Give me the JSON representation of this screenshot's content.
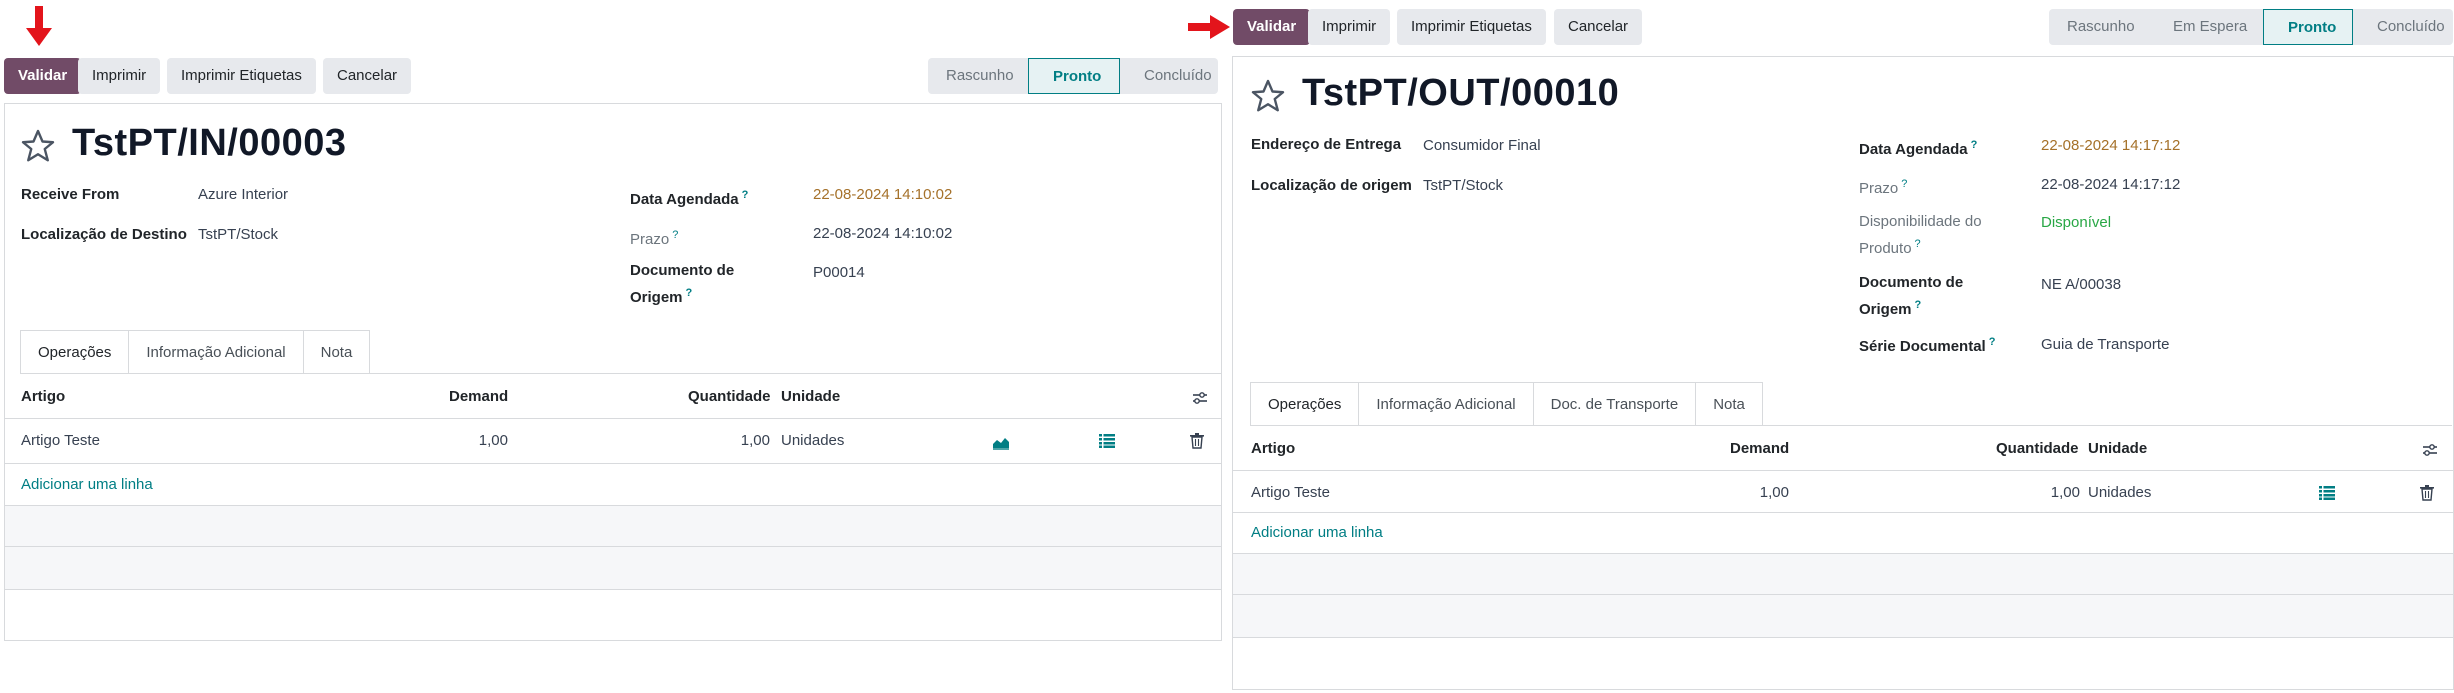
{
  "left": {
    "buttons": {
      "validate": "Validar",
      "print": "Imprimir",
      "print_labels": "Imprimir Etiquetas",
      "cancel": "Cancelar"
    },
    "status": [
      "Rascunho",
      "Pronto",
      "Concluído"
    ],
    "status_active": "Pronto",
    "title": "TstPT/IN/00003",
    "fields": {
      "receive_from_label": "Receive From",
      "receive_from_value": "Azure Interior",
      "dest_location_label": "Localização de Destino",
      "dest_location_value": "TstPT/Stock",
      "scheduled_label": "Data Agendada",
      "scheduled_value": "22-08-2024 14:10:02",
      "deadline_label": "Prazo",
      "deadline_value": "22-08-2024 14:10:02",
      "origin_label_1": "Documento de",
      "origin_label_2": "Origem",
      "origin_value": "P00014"
    },
    "tabs": [
      "Operações",
      "Informação Adicional",
      "Nota"
    ],
    "table": {
      "headers": [
        "Artigo",
        "Demand",
        "Quantidade",
        "Unidade"
      ],
      "row": {
        "product": "Artigo Teste",
        "demand": "1,00",
        "quantity": "1,00",
        "unit": "Unidades"
      },
      "add_line": "Adicionar uma linha"
    }
  },
  "right": {
    "buttons": {
      "validate": "Validar",
      "print": "Imprimir",
      "print_labels": "Imprimir Etiquetas",
      "cancel": "Cancelar"
    },
    "status": [
      "Rascunho",
      "Em Espera",
      "Pronto",
      "Concluído"
    ],
    "status_active": "Pronto",
    "title": "TstPT/OUT/00010",
    "fields": {
      "delivery_address_label": "Endereço de Entrega",
      "delivery_address_value": "Consumidor Final",
      "source_location_label": "Localização de origem",
      "source_location_value": "TstPT/Stock",
      "scheduled_label": "Data Agendada",
      "scheduled_value": "22-08-2024 14:17:12",
      "deadline_label": "Prazo",
      "deadline_value": "22-08-2024 14:17:12",
      "availability_label_1": "Disponibilidade do",
      "availability_label_2": "Produto",
      "availability_value": "Disponível",
      "origin_label_1": "Documento de",
      "origin_label_2": "Origem",
      "origin_value": "NE A/00038",
      "doc_series_label": "Série Documental",
      "doc_series_value": "Guia de Transporte"
    },
    "tabs": [
      "Operações",
      "Informação Adicional",
      "Doc. de Transporte",
      "Nota"
    ],
    "table": {
      "headers": [
        "Artigo",
        "Demand",
        "Quantidade",
        "Unidade"
      ],
      "row": {
        "product": "Artigo Teste",
        "demand": "1,00",
        "quantity": "1,00",
        "unit": "Unidades"
      },
      "add_line": "Adicionar uma linha"
    }
  },
  "colors": {
    "primary": "#714b67",
    "accent": "#017e84",
    "date": "#a5712a",
    "available": "#28a745",
    "arrow": "#e3141b"
  },
  "icons": [
    "down-arrow-icon",
    "right-arrow-icon",
    "star-icon",
    "forecast-chart-icon",
    "details-list-icon",
    "trash-icon",
    "optional-columns-icon"
  ]
}
